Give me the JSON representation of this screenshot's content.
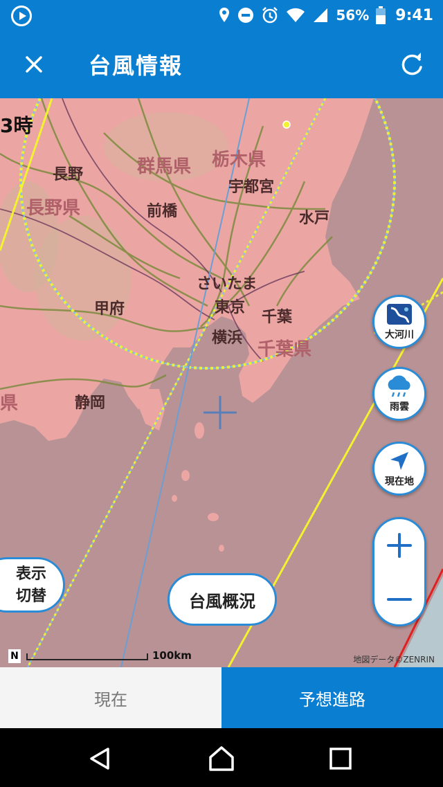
{
  "status_bar": {
    "battery_percent": "56%",
    "time": "9:41",
    "icons": [
      "play-circle-icon",
      "location-icon",
      "do-not-disturb-icon",
      "alarm-icon",
      "wifi-icon",
      "signal-icon",
      "battery-icon"
    ]
  },
  "app_bar": {
    "title": "台風情報",
    "close_icon": "close-icon",
    "refresh_icon": "refresh-icon"
  },
  "map": {
    "time_label": "3時",
    "labels": {
      "gunma": "群馬県",
      "tochigi": "栃木県",
      "nagano_city": "長野",
      "nagano_pref": "長野県",
      "utsunomiya": "宇都宮",
      "maebashi": "前橋",
      "mito": "水戸",
      "saitama": "さいたま",
      "kofu": "甲府",
      "tokyo": "東京",
      "chiba_city": "千葉",
      "yokohama": "横浜",
      "chiba_pref": "千葉県",
      "shizuoka": "静岡",
      "shizuoka_pref_edge": "県"
    },
    "buttons": {
      "river": "大河川",
      "rain_cloud": "雨雲",
      "location": "現在地",
      "zoom_in": "+",
      "zoom_out": "−",
      "toggle_display": [
        "表示",
        "切替"
      ],
      "typhoon_overview": "台風概況"
    },
    "scale_label": "100km",
    "credit": "地図データ©ZENRIN",
    "colors": {
      "land": "#eba6a4",
      "sea": "#b89294",
      "forecast_circle": "#e8ef3c",
      "warning_line": "#e02020"
    }
  },
  "tabs": {
    "current": "現在",
    "forecast": "予想進路"
  },
  "nav": {
    "back_icon": "back-triangle-icon",
    "home_icon": "home-circle-icon",
    "recents_icon": "recents-square-icon"
  }
}
